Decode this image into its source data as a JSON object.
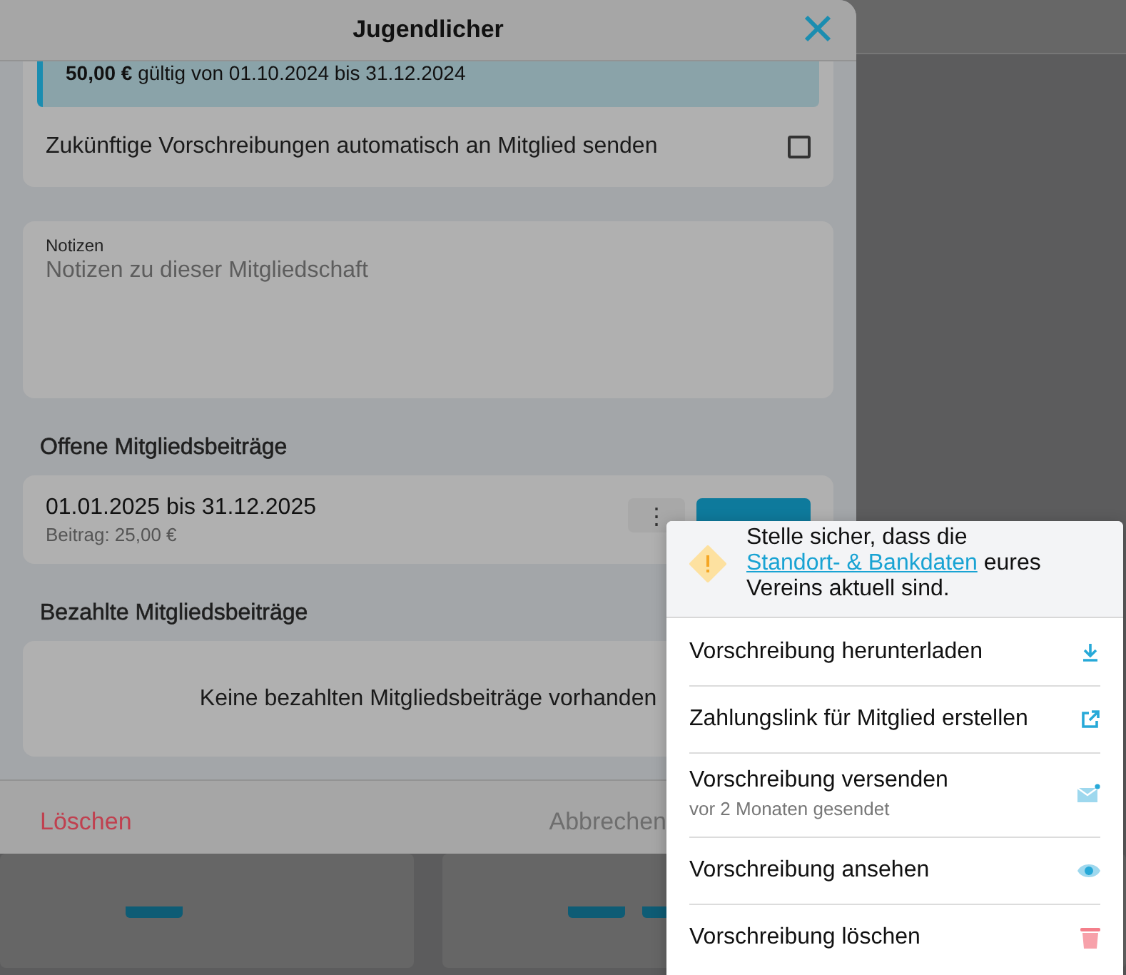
{
  "dialog": {
    "title": "Jugendlicher",
    "fee_info": {
      "amount": "50,00 €",
      "validity": "gültig von 01.10.2024 bis 31.12.2024"
    },
    "auto_send": {
      "label": "Zukünftige Vorschreibungen automatisch an Mitglied senden",
      "checked": false
    },
    "notes": {
      "label": "Notizen",
      "placeholder": "Notizen zu dieser Mitgliedschaft"
    },
    "open_fees": {
      "heading": "Offene Mitgliedsbeiträge",
      "rows": [
        {
          "period": "01.01.2025 bis 31.12.2025",
          "amount": "Beitrag: 25,00 €",
          "menu_button": "⋮"
        }
      ]
    },
    "paid_fees": {
      "heading": "Bezahlte Mitgliedsbeiträge",
      "empty_text": "Keine bezahlten Mitgliedsbeiträge vorhanden"
    },
    "footer": {
      "delete_button": "Löschen",
      "cancel_button": "Abbrechen"
    }
  },
  "menu": {
    "notice": {
      "before": "Stelle sicher, dass die",
      "link": "Standort- & Bankdaten",
      "after": "eures Vereins aktuell sind."
    },
    "items": [
      {
        "kind": "download",
        "label": "Vorschreibung herunterladen"
      },
      {
        "kind": "link",
        "label": "Zahlungslink für Mitglied erstellen"
      },
      {
        "kind": "send",
        "label": "Vorschreibung versenden",
        "sublabel": "vor 2 Monaten gesendet"
      },
      {
        "kind": "view",
        "label": "Vorschreibung ansehen"
      },
      {
        "kind": "delete",
        "label": "Vorschreibung löschen"
      }
    ]
  }
}
